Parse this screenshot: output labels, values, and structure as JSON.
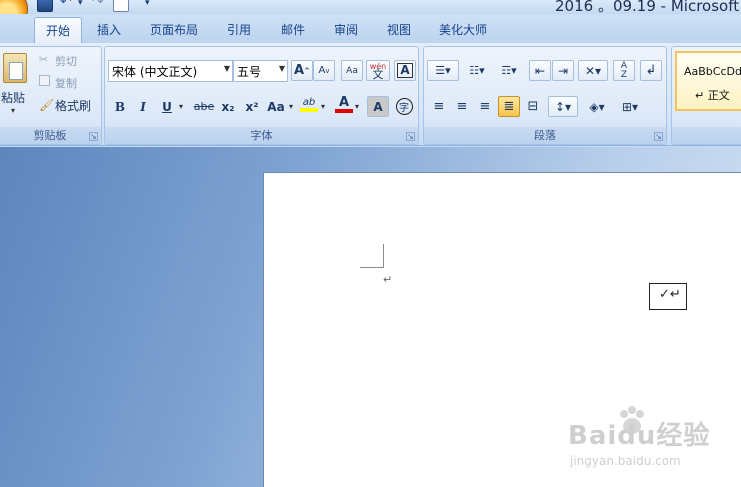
{
  "window": {
    "title": "2016 。09.19 - Microsoft"
  },
  "tabs": [
    {
      "label": "开始",
      "active": true
    },
    {
      "label": "插入"
    },
    {
      "label": "页面布局"
    },
    {
      "label": "引用"
    },
    {
      "label": "邮件"
    },
    {
      "label": "审阅"
    },
    {
      "label": "视图"
    },
    {
      "label": "美化大师"
    }
  ],
  "clipboard": {
    "group_label": "剪贴板",
    "paste": "粘贴",
    "cut": "剪切",
    "copy": "复制",
    "format_painter": "格式刷"
  },
  "font": {
    "group_label": "字体",
    "font_name": "宋体 (中文正文)",
    "font_size": "五号",
    "grow": "A",
    "shrink": "A",
    "phonetic": "wén",
    "border_char": "A",
    "bold": "B",
    "italic": "I",
    "underline": "U",
    "strike": "abe",
    "subscript": "x₂",
    "superscript": "x²",
    "change_case": "Aa",
    "highlight": "ab",
    "font_color": "A",
    "char_shading": "A",
    "enclose": "字",
    "highlight_color": "#ffff00",
    "font_color_value": "#e00000"
  },
  "paragraph": {
    "group_label": "段落"
  },
  "styles": {
    "sample": "AaBbCcDd",
    "name": "正文"
  },
  "document": {
    "checkbox_text": "✓↵",
    "para_mark": "↵"
  },
  "watermark": {
    "brand": "Baidu经验",
    "url": "jingyan.baidu.com"
  }
}
